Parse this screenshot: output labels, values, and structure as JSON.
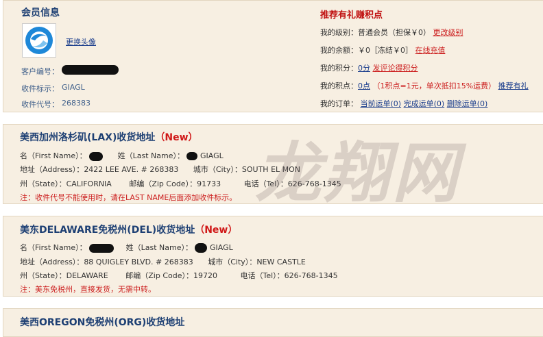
{
  "member": {
    "title": "会员信息",
    "change_avatar": "更换头像",
    "customer_no_label": "客户编号：",
    "recipient_mark_label": "收件标示：",
    "recipient_mark_value": "GIAGL",
    "recipient_code_label": "收件代号：",
    "recipient_code_value": "268383"
  },
  "account": {
    "promo": "推荐有礼赚积点",
    "level_label": "我的级别：",
    "level_value": "普通会员（担保￥0）",
    "level_link": "更改级别",
    "balance_label": "我的余额：",
    "balance_value": "￥0［冻结￥0］",
    "balance_link": "在线充值",
    "score_label": "我的积分：",
    "score_value": "0分",
    "score_link": "发评论得积分",
    "points_label": "我的积点：",
    "points_value": "0点",
    "points_note": "（1积点=1元，单次抵扣15%运费）",
    "points_link": "推荐有礼",
    "orders_label": "我的订单：",
    "orders_current": "当前运单(0)",
    "orders_done": "完成运单(0)",
    "orders_deleted": "删除运单(0)"
  },
  "lax": {
    "title": "美西加州洛杉矶(LAX)收货地址",
    "new": "（New）",
    "first_name_label": "名（First Name）：",
    "last_name_label": "姓（Last Name）：",
    "last_name_value": "GIAGL",
    "address_label": "地址（Address）：",
    "address_value": "2422 LEE AVE. # 268383",
    "city_label": "城市（City）：",
    "city_value": "SOUTH EL MON",
    "state_label": "州（State）：",
    "state_value": "CALIFORNIA",
    "zip_label": "邮编（Zip Code）：",
    "zip_value": "91733",
    "tel_label": "电话（Tel）：",
    "tel_value": "626-768-1345",
    "note": "注：收件代号不能使用时，请在LAST NAME后面添加收件标示。"
  },
  "del": {
    "title": "美东DELAWARE免税州(DEL)收货地址",
    "new": "（New）",
    "first_name_label": "名（First Name）：",
    "last_name_label": "姓（Last Name）：",
    "last_name_value": "GIAGL",
    "address_label": "地址（Address）：",
    "address_value": "88 QUIGLEY BLVD. # 268383",
    "city_label": "城市（City）：",
    "city_value": "NEW CASTLE",
    "state_label": "州（State）：",
    "state_value": "DELAWARE",
    "zip_label": "邮编（Zip Code）：",
    "zip_value": "19720",
    "tel_label": "电话（Tel）：",
    "tel_value": "626-768-1345",
    "note": "注：美东免税州，直接发货，无需中转。"
  },
  "org": {
    "title": "美西OREGON免税州(ORG)收货地址"
  },
  "watermark": "龙翔网"
}
